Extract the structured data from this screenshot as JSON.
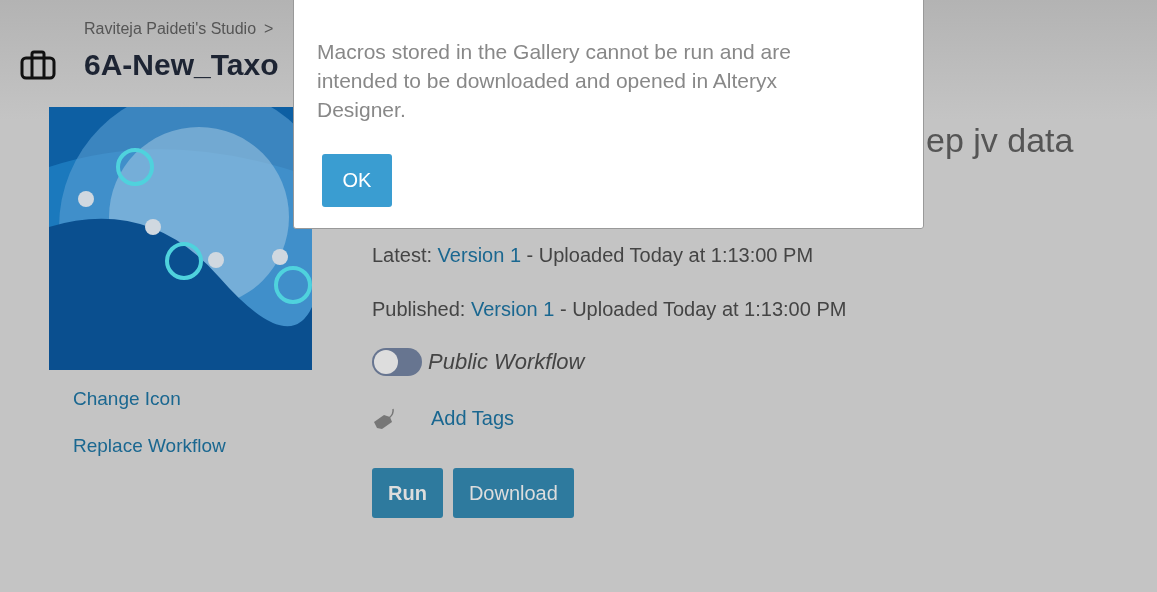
{
  "breadcrumb": {
    "label": "Raviteja Paideti's Studio",
    "separator": ">"
  },
  "title": "6A-New_Taxo",
  "subtitle": "ep jv data",
  "side_links": [
    "Change Icon",
    "Replace Workflow"
  ],
  "versions": [
    {
      "label": "Latest:",
      "link": "Version 1",
      "detail": "- Uploaded Today at 1:13:00 PM"
    },
    {
      "label": "Published:",
      "link": "Version 1",
      "detail": "- Uploaded Today at 1:13:00 PM"
    }
  ],
  "public_toggle": {
    "label": "Public Workflow",
    "on": false
  },
  "tags_link": "Add Tags",
  "buttons": [
    {
      "label": "Run",
      "kind": "primary"
    },
    {
      "label": "Download",
      "kind": "secondary"
    }
  ],
  "dialog": {
    "message": "Macros stored in the Gallery cannot be run and are intended to be downloaded and opened in Alteryx Designer.",
    "button": "OK"
  }
}
